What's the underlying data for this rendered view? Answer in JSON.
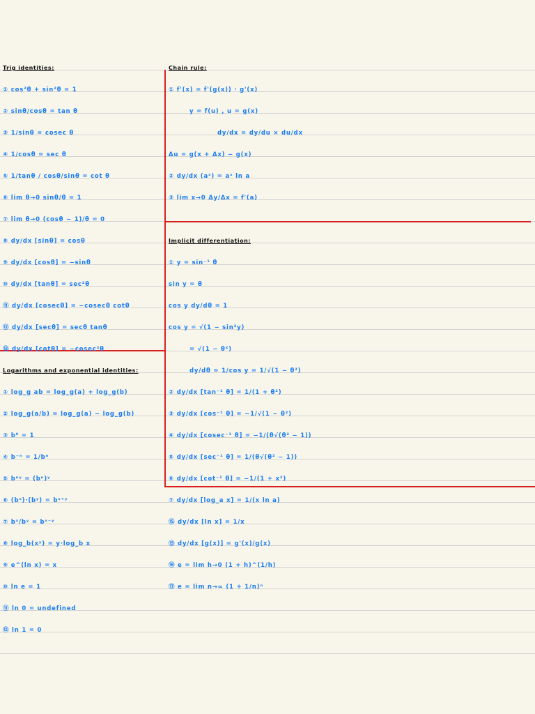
{
  "colors": {
    "ink": "#1a7cf5",
    "margin": "#d81f1f",
    "paper": "#f8f6ea"
  },
  "left": {
    "trig": {
      "heading": "Trig identities:",
      "items": [
        "① cos²θ + sin²θ = 1",
        "② sinθ/cosθ = tan θ",
        "③ 1/sinθ = cosec θ",
        "④ 1/cosθ = sec θ",
        "⑤ 1/tanθ / cosθ/sinθ = cot θ",
        "⑥ lim θ→0  sinθ/θ = 1",
        "⑦ lim θ→0  (cosθ − 1)/θ = 0",
        "⑧ dy/dx [sinθ] = cosθ",
        "⑨ dy/dx [cosθ] = −sinθ",
        "⑩ dy/dx [tanθ] = sec²θ",
        "⑪ dy/dx [cosecθ] = −cosecθ cotθ",
        "⑫ dy/dx [secθ] = secθ tanθ",
        "⑬ dy/dx [cotθ] = −cosec²θ"
      ]
    },
    "logs": {
      "heading": "Logarithms and exponential identities:",
      "items": [
        "① log_g ab = log_g(a) + log_g(b)",
        "② log_g(a/b) = log_g(a) − log_g(b)",
        "③ b⁰ = 1",
        "④ b⁻ⁿ = 1/bⁿ",
        "⑤ bⁿʸ = (bⁿ)ʸ",
        "⑥ (bˣ)·(bʸ) = bˣ⁺ʸ",
        "⑦ bˣ/bʸ = bˣ⁻ʸ",
        "⑧ log_b(xʸ) = y·log_b x",
        "⑨ e^(ln x) = x",
        "⑩ ln e = 1",
        "⑪ ln 0 = undefined",
        "⑫ ln 1 = 0"
      ]
    }
  },
  "right": {
    "chain": {
      "heading": "Chain rule:",
      "items": [
        "① f'(x) = f'(g(x)) · g'(x)",
        "y = f(u) , u = g(x)",
        "dy/dx = dy/du × du/dx",
        "Δu = g(x + Δx) − g(x)",
        "② dy/dx (aˣ) = aˣ ln a",
        "③ lim x→0  Δy/Δx = f'(a)"
      ]
    },
    "implicit": {
      "heading": "Implicit differentiation:",
      "items": [
        "① y = sin⁻¹ θ",
        "sin y = θ",
        "cos y dy/dθ = 1",
        "cos y = √(1 − sin²y)",
        "= √(1 − θ²)",
        "dy/dθ = 1/cos y = 1/√(1 − θ²)",
        "② dy/dx [tan⁻¹ θ] = 1/(1 + θ²)",
        "③ dy/dx [cos⁻¹ θ] = −1/√(1 − θ²)",
        "④ dy/dx [cosec⁻¹ θ] = −1/(θ√(θ² − 1))",
        "⑤ dy/dx [sec⁻¹ θ] = 1/(θ√(θ² − 1))",
        "⑥ dy/dx [cot⁻¹ θ] = −1/(1 + x²)",
        "⑦ dy/dx [log_a x] = 1/(x ln a)",
        "⑮ dy/dx [ln x] = 1/x",
        "⑮ dy/dx [g(x)] = g'(x)/g(x)",
        "⑯ e = lim h→0 (1 + h)^(1/h)",
        "⑰ e = lim n→∞ (1 + 1/n)ⁿ"
      ]
    }
  }
}
